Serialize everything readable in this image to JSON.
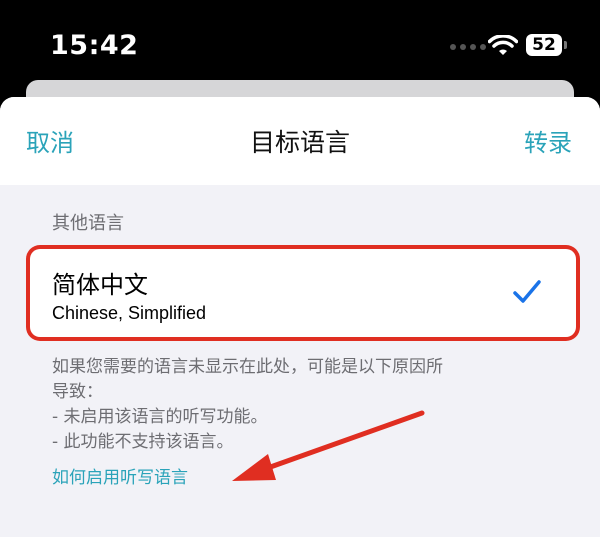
{
  "status_bar": {
    "time": "15:42",
    "battery": "52"
  },
  "nav": {
    "cancel": "取消",
    "title": "目标语言",
    "transcribe": "转录"
  },
  "section": {
    "header": "其他语言"
  },
  "language_option": {
    "name": "简体中文",
    "subtitle": "Chinese, Simplified",
    "selected": true
  },
  "footer": {
    "lines": [
      "如果您需要的语言未显示在此处，可能是以下原因所",
      "导致：",
      "- 未启用该语言的听写功能。",
      "- 此功能不支持该语言。"
    ],
    "help_link": "如何启用听写语言"
  },
  "colors": {
    "accent": "#2aa3b9",
    "highlight_box": "#e02e21",
    "check": "#1a73e8"
  },
  "icons": [
    "wifi-icon",
    "battery-icon",
    "checkmark-icon",
    "red-arrow-annotation"
  ]
}
